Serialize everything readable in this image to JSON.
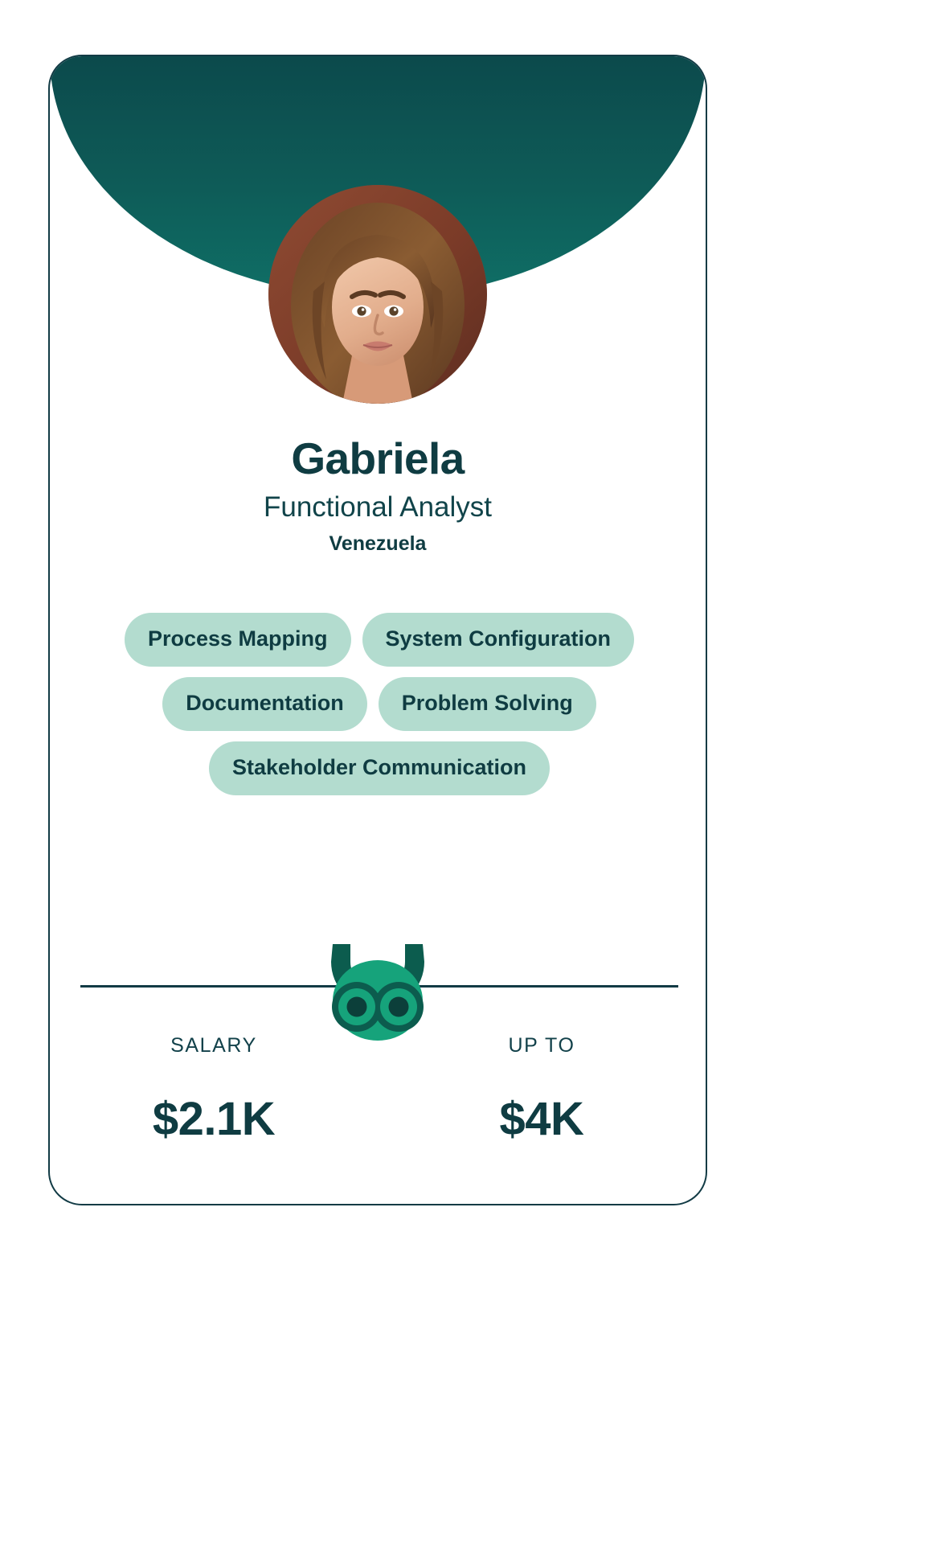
{
  "card": {
    "person": {
      "name": "Gabriela",
      "role": "Functional Analyst",
      "country": "Venezuela",
      "avatar_icon": "profile-photo"
    },
    "skills": [
      "Process Mapping",
      "System Configuration",
      "Documentation",
      "Problem Solving",
      "Stakeholder Communication"
    ],
    "brand": {
      "logo_icon": "owl-logo"
    },
    "salary": {
      "base_label": "SALARY",
      "base_value": "$2.1K",
      "max_label": "UP TO",
      "max_value": "$4K"
    },
    "colors": {
      "header_teal": "#0e5c58",
      "text_dark_teal": "#0f3c42",
      "pill_mint": "#b3dccf",
      "owl_green": "#16a37b",
      "owl_dark": "#0c5c4e",
      "border": "#123b45"
    }
  }
}
